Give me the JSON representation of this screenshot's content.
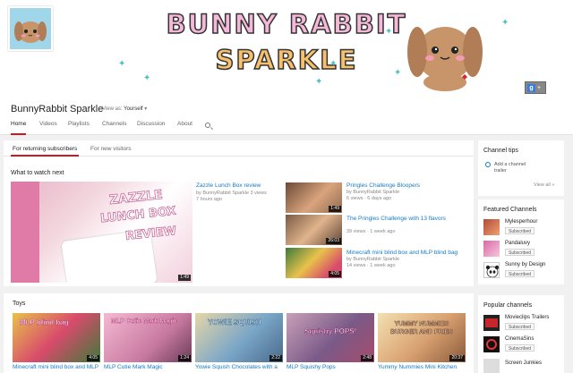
{
  "banner": {
    "title_line1": "BUNNY RABBIT",
    "title_line2": "SPARKLE"
  },
  "channel": {
    "name": "BunnyRabbit Sparkle",
    "view_as_label": "View as:",
    "view_as_value": "Yourself"
  },
  "tabs": [
    "Home",
    "Videos",
    "Playlists",
    "Channels",
    "Discussion",
    "About"
  ],
  "subtabs": [
    "For returning subscribers",
    "For new visitors"
  ],
  "sections": {
    "what_to_watch": "What to watch next",
    "toys": "Toys"
  },
  "featured": {
    "title": "Zazzle Lunch Box review",
    "byline": "by BunnyRabbit Sparkle",
    "views": "3 views",
    "age": "7 hours ago",
    "duration": "1:49",
    "overlay_line1": "ZAZZLE",
    "overlay_line2": "LUNCH BOX",
    "overlay_line3": "REVIEW"
  },
  "related": [
    {
      "title": "Pringles Challenge Bloopers",
      "byline": "by BunnyRabbit Sparkle",
      "meta": "6 views · 6 days ago",
      "duration": "1:49"
    },
    {
      "title": "The Pringles Challenge with 13 flavors",
      "byline": "",
      "meta": "39 views · 1 week ago",
      "duration": "26:03"
    },
    {
      "title": "Minecraft mini blind box and MLP blind bag",
      "byline": "by BunnyRabbit Sparkle",
      "meta": "14 views · 1 week ago",
      "duration": "4:05"
    }
  ],
  "channel_tips": {
    "heading": "Channel tips",
    "tip": "Add a channel trailer",
    "view_all": "View all »"
  },
  "featured_channels": {
    "heading": "Featured Channels",
    "items": [
      {
        "name": "Mylesperhour",
        "button": "Subscribed"
      },
      {
        "name": "Pandaluvy",
        "button": "Subscribed"
      },
      {
        "name": "Sunny by Design",
        "button": "Subscribed"
      }
    ]
  },
  "popular_channels": {
    "heading": "Popular channels",
    "items": [
      {
        "name": "Movieclips Trailers",
        "button": "Subscribed"
      },
      {
        "name": "CinemaSins",
        "button": "Subscribed"
      },
      {
        "name": "Screen Junkies",
        "button": ""
      }
    ]
  },
  "toys": [
    {
      "title": "Minecraft mini blind box and MLP",
      "duration": "4:05",
      "overlay": "MLP blind bag"
    },
    {
      "title": "MLP Cutie Mark Magic",
      "duration": "1:24",
      "overlay": "MLP Cutie Mark Magic"
    },
    {
      "title": "Yowie Squish Chocolates with a",
      "duration": "2:22",
      "overlay": "YOWIE SQUISH"
    },
    {
      "title": "MLP Squishy Pops",
      "duration": "2:48",
      "overlay": "Squishy POPS!"
    },
    {
      "title": "Yummy Nummies Mini Kitchen",
      "duration": "20:37",
      "overlay": "YUMMY NUMMIES BURGER AND FRIES"
    }
  ],
  "colors": {
    "accent_red": "#cc181e",
    "link_blue": "#167ac6"
  }
}
